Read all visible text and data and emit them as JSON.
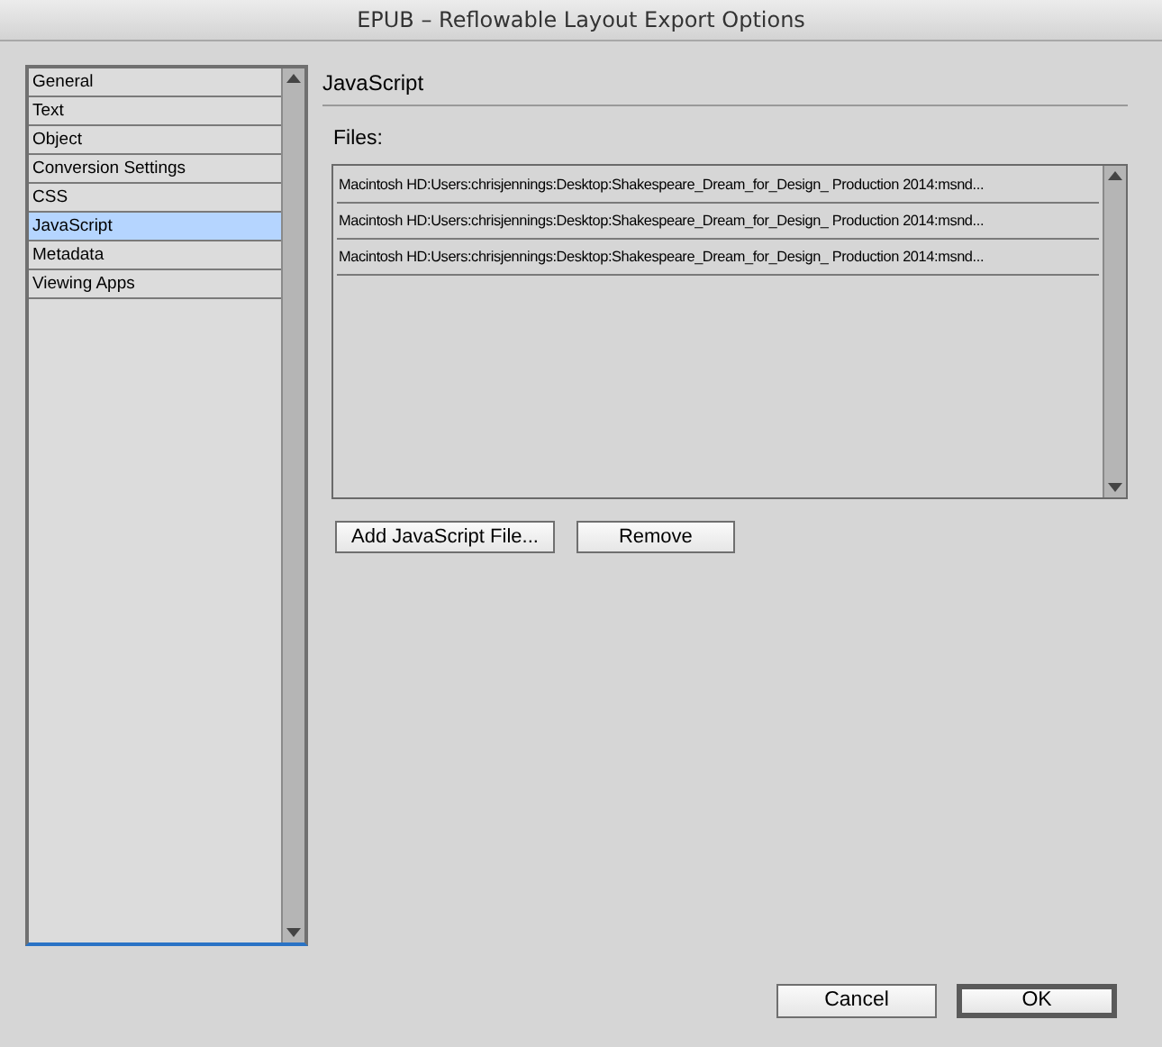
{
  "window": {
    "title": "EPUB – Reflowable Layout Export Options"
  },
  "sidebar": {
    "items": [
      {
        "label": "General",
        "selected": false
      },
      {
        "label": "Text",
        "selected": false
      },
      {
        "label": "Object",
        "selected": false
      },
      {
        "label": "Conversion Settings",
        "selected": false
      },
      {
        "label": "CSS",
        "selected": false
      },
      {
        "label": "JavaScript",
        "selected": true
      },
      {
        "label": "Metadata",
        "selected": false
      },
      {
        "label": "Viewing Apps",
        "selected": false
      }
    ]
  },
  "section_title": "JavaScript",
  "files": {
    "label": "Files:",
    "rows": [
      "Macintosh HD:Users:chrisjennings:Desktop:Shakespeare_Dream_for_Design_ Production 2014:msnd...",
      "Macintosh HD:Users:chrisjennings:Desktop:Shakespeare_Dream_for_Design_ Production 2014:msnd...",
      "Macintosh HD:Users:chrisjennings:Desktop:Shakespeare_Dream_for_Design_ Production 2014:msnd..."
    ]
  },
  "file_buttons": [
    "Add JavaScript File...",
    "Remove"
  ],
  "dialog_buttons": [
    {
      "label": "Cancel",
      "kind": "normal"
    },
    {
      "label": "OK",
      "kind": "default"
    }
  ]
}
